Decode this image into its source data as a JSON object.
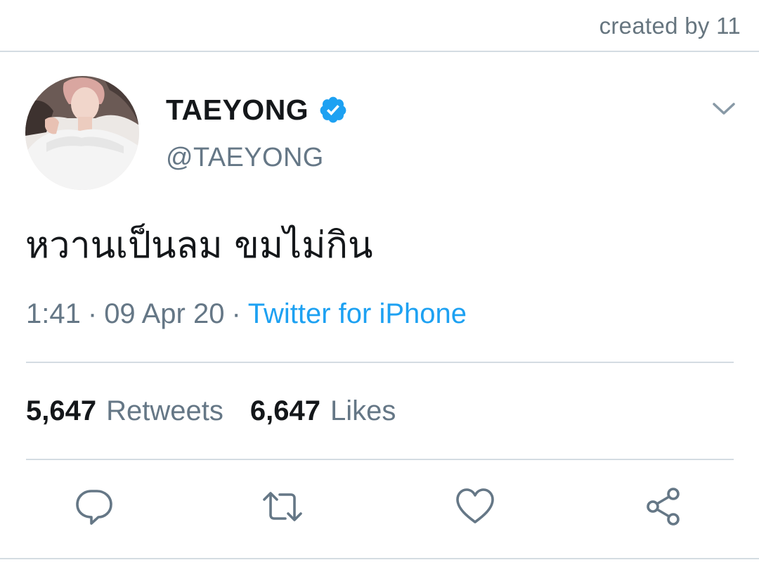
{
  "watermark": "created by 11",
  "tweet": {
    "display_name": "TAEYONG",
    "handle": "@TAEYONG",
    "verified": true,
    "text": "หวานเป็นลม ขมไม่กิน",
    "time": "1:41",
    "date": "09 Apr 20",
    "separator": "·",
    "source": "Twitter for iPhone",
    "retweets_count": "5,647",
    "retweets_label": "Retweets",
    "likes_count": "6,647",
    "likes_label": "Likes"
  },
  "icons": {
    "verified": "verified-badge-icon",
    "menu": "chevron-down-icon",
    "reply": "reply-icon",
    "retweet": "retweet-icon",
    "like": "heart-icon",
    "share": "share-icon"
  },
  "colors": {
    "accent": "#1da1f2",
    "text_primary": "#14171a",
    "text_secondary": "#657786",
    "divider": "#d4dce2",
    "icon": "#657786"
  }
}
